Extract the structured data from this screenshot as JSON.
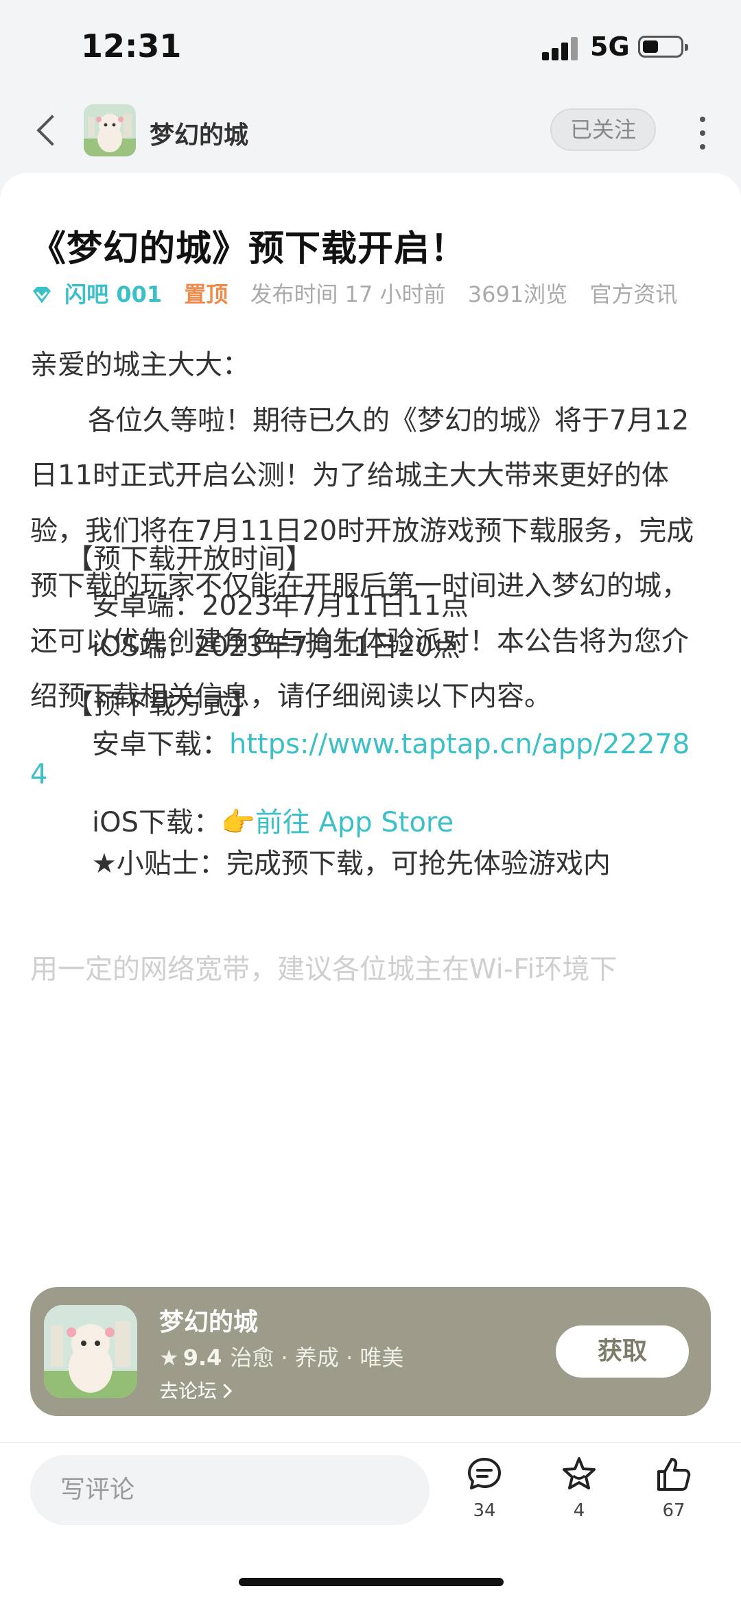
{
  "status_bar": {
    "time": "12:31",
    "network": "5G"
  },
  "header": {
    "forum_name": "梦幻的城",
    "follow_label": "已关注"
  },
  "post": {
    "title": "《梦幻的城》预下载开启！",
    "author": "闪吧 001",
    "pinned": "置顶",
    "publish_time": "发布时间 17 小时前",
    "views": "3691浏览",
    "category": "官方资讯",
    "greeting": "亲爱的城主大大：",
    "paragraph": "各位久等啦！期待已久的《梦幻的城》将于7月12日11时正式开启公测！为了给城主大大带来更好的体验，我们将在7月11日20时开放游戏预下载服务，完成预下载的玩家不仅能在开服后第一时间进入梦幻的城，还可以优先创建角色与抢先体验派对！本公告将为您介绍预下载相关信息，请仔细阅读以下内容。",
    "section1": {
      "heading": "【预下载开放时间】",
      "android": "安卓端：2023年7月11日11点",
      "ios": "iOS端：2023年7月11日20点"
    },
    "section2": {
      "heading": "【预下载方式】",
      "android_label": "安卓下载：",
      "android_link_line1": "https://www.taptap.cn/app/22278",
      "android_link_line2": "4",
      "ios_label": "iOS下载：",
      "ios_emoji": "👉",
      "ios_link": "前往 App Store",
      "tip": "★小贴士：完成预下载，可抢先体验游戏内"
    },
    "partial_text": "用一定的网络宽带，建议各位城主在Wi-Fi环境下"
  },
  "promo": {
    "app_name": "梦幻的城",
    "rating": "9.4",
    "tags": "治愈 · 养成 · 唯美",
    "forum_link": "去论坛",
    "get_label": "获取"
  },
  "bottom_bar": {
    "comment_placeholder": "写评论",
    "comments": "34",
    "favorites": "4",
    "likes": "67"
  }
}
